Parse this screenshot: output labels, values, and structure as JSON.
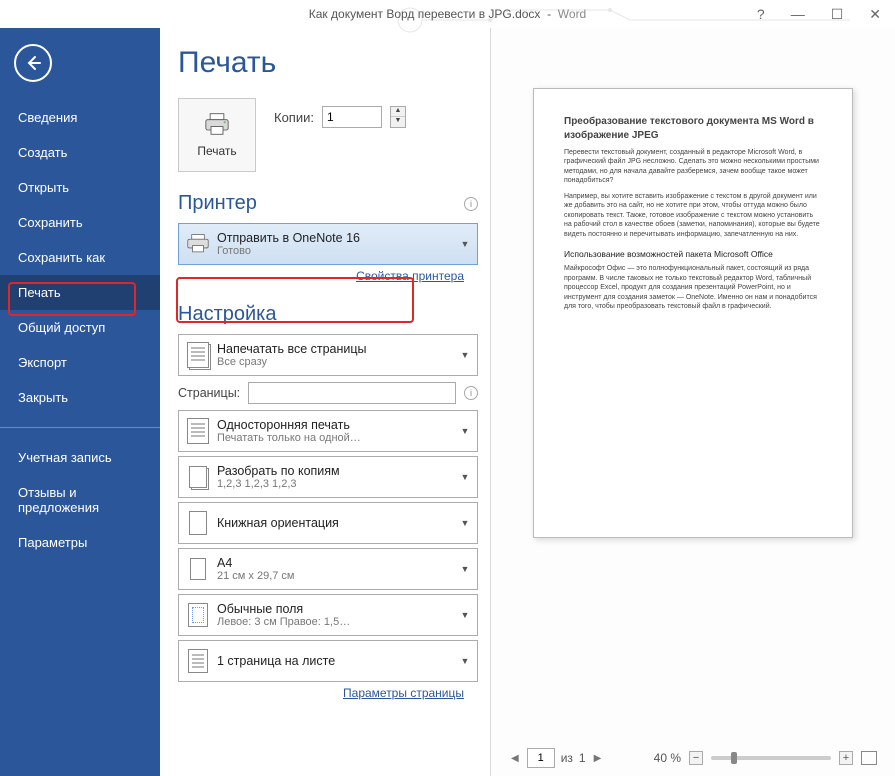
{
  "titlebar": {
    "document": "Как документ Ворд перевести в JPG.docx",
    "app": "Word",
    "help": "?",
    "minimize": "—",
    "maximize": "☐",
    "close": "✕"
  },
  "sidebar": {
    "items": [
      {
        "label": "Сведения"
      },
      {
        "label": "Создать"
      },
      {
        "label": "Открыть"
      },
      {
        "label": "Сохранить"
      },
      {
        "label": "Сохранить как"
      },
      {
        "label": "Печать",
        "active": true
      },
      {
        "label": "Общий доступ"
      },
      {
        "label": "Экспорт"
      },
      {
        "label": "Закрыть"
      }
    ],
    "group2": [
      {
        "label": "Учетная запись"
      },
      {
        "label": "Отзывы и предложения"
      },
      {
        "label": "Параметры"
      }
    ]
  },
  "print": {
    "heading": "Печать",
    "button_label": "Печать",
    "copies_label": "Копии:",
    "copies_value": "1"
  },
  "printer": {
    "heading": "Принтер",
    "selected": "Отправить в OneNote 16",
    "status": "Готово",
    "link": "Свойства принтера"
  },
  "settings": {
    "heading": "Настройка",
    "range": {
      "t1": "Напечатать все страницы",
      "t2": "Все сразу"
    },
    "pages_label": "Страницы:",
    "pages_value": "",
    "sides": {
      "t1": "Односторонняя печать",
      "t2": "Печатать только на одной…"
    },
    "collate": {
      "t1": "Разобрать по копиям",
      "t2": "1,2,3    1,2,3    1,2,3"
    },
    "orientation": {
      "t1": "Книжная ориентация",
      "t2": ""
    },
    "paper": {
      "t1": "A4",
      "t2": "21 см x 29,7 см"
    },
    "margins": {
      "t1": "Обычные поля",
      "t2": "Левое: 3 см   Правое: 1,5…"
    },
    "per_sheet": {
      "t1": "1 страница на листе",
      "t2": ""
    },
    "page_setup_link": "Параметры страницы"
  },
  "preview": {
    "doc_title": "Преобразование текстового документа MS Word в изображение JPEG",
    "p1": "Перевести текстовый документ, созданный в редакторе Microsoft Word, в графический файл JPG несложно. Сделать это можно несколькими простыми методами, но для начала давайте разберемся, зачем вообще такое может понадобиться?",
    "p2": "Например, вы хотите вставить изображение с текстом в другой документ или же добавить это на сайт, но не хотите при этом, чтобы оттуда можно было скопировать текст. Также, готовое изображение с текстом можно установить на рабочий стол в качестве обоев (заметки, напоминания), которые вы будете видеть постоянно и перечитывать информацию, запечатленную на них.",
    "h2": "Использование возможностей пакета Microsoft Office",
    "p3": "Майкрософт Офис — это полнофункциональный пакет, состоящий из ряда программ. В числе таковых не только текстовый редактор Word, табличный процессор Excel, продукт для создания презентаций PowerPoint, но и инструмент для создания заметок — OneNote. Именно он нам и понадобится для того, чтобы преобразовать текстовый файл в графический."
  },
  "footer": {
    "current_page": "1",
    "of_label": "из",
    "total_pages": "1",
    "zoom_label": "40 %"
  }
}
